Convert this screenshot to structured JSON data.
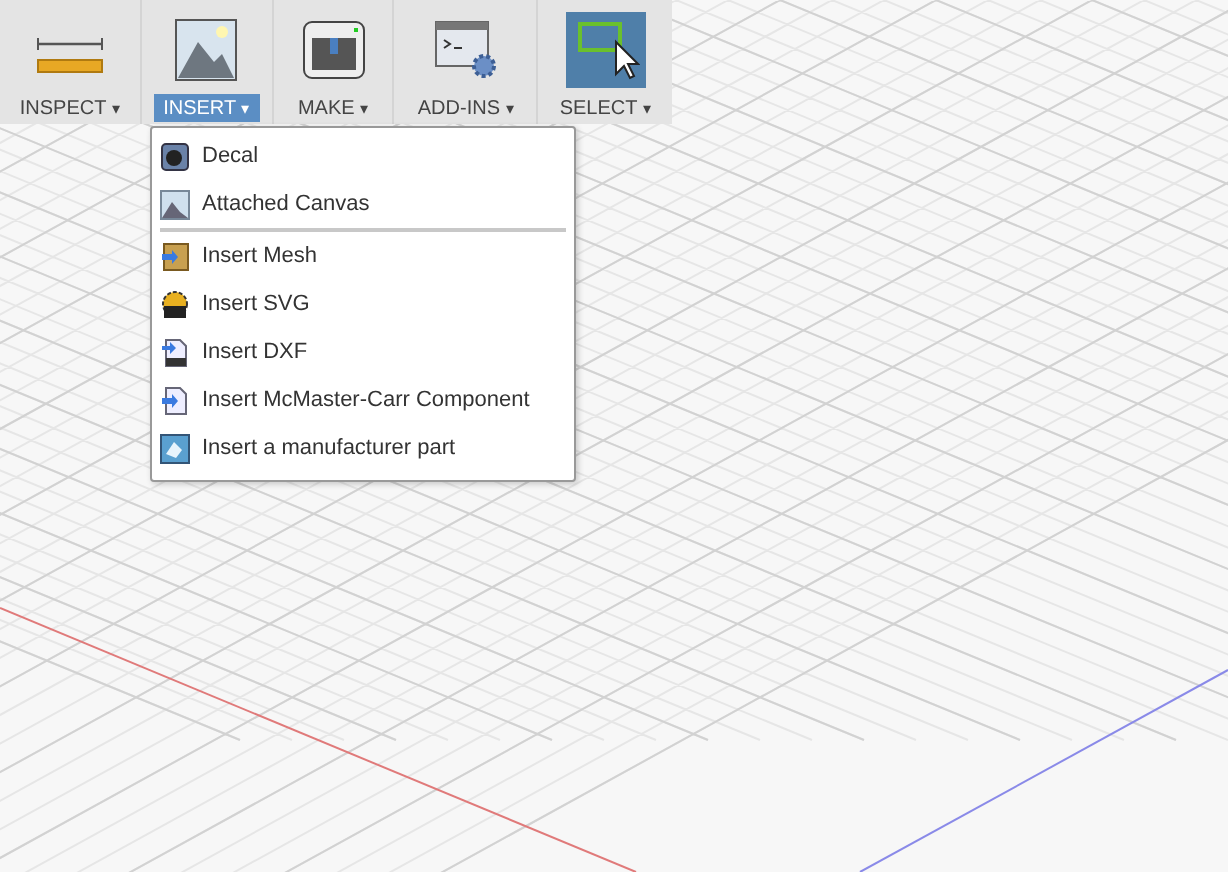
{
  "toolbar": {
    "groups": [
      {
        "label": "INSPECT",
        "caret": "▾",
        "selected": false,
        "active": false
      },
      {
        "label": "INSERT",
        "caret": "▾",
        "selected": true,
        "active": false
      },
      {
        "label": "MAKE",
        "caret": "▾",
        "selected": false,
        "active": false
      },
      {
        "label": "ADD-INS",
        "caret": "▾",
        "selected": false,
        "active": false
      },
      {
        "label": "SELECT",
        "caret": "▾",
        "selected": false,
        "active": true
      }
    ]
  },
  "menu": {
    "sections": [
      [
        {
          "label": "Decal"
        },
        {
          "label": "Attached Canvas"
        }
      ],
      [
        {
          "label": "Insert Mesh"
        },
        {
          "label": "Insert SVG"
        },
        {
          "label": "Insert DXF"
        },
        {
          "label": "Insert McMaster-Carr Component"
        },
        {
          "label": "Insert a manufacturer part"
        }
      ]
    ]
  }
}
